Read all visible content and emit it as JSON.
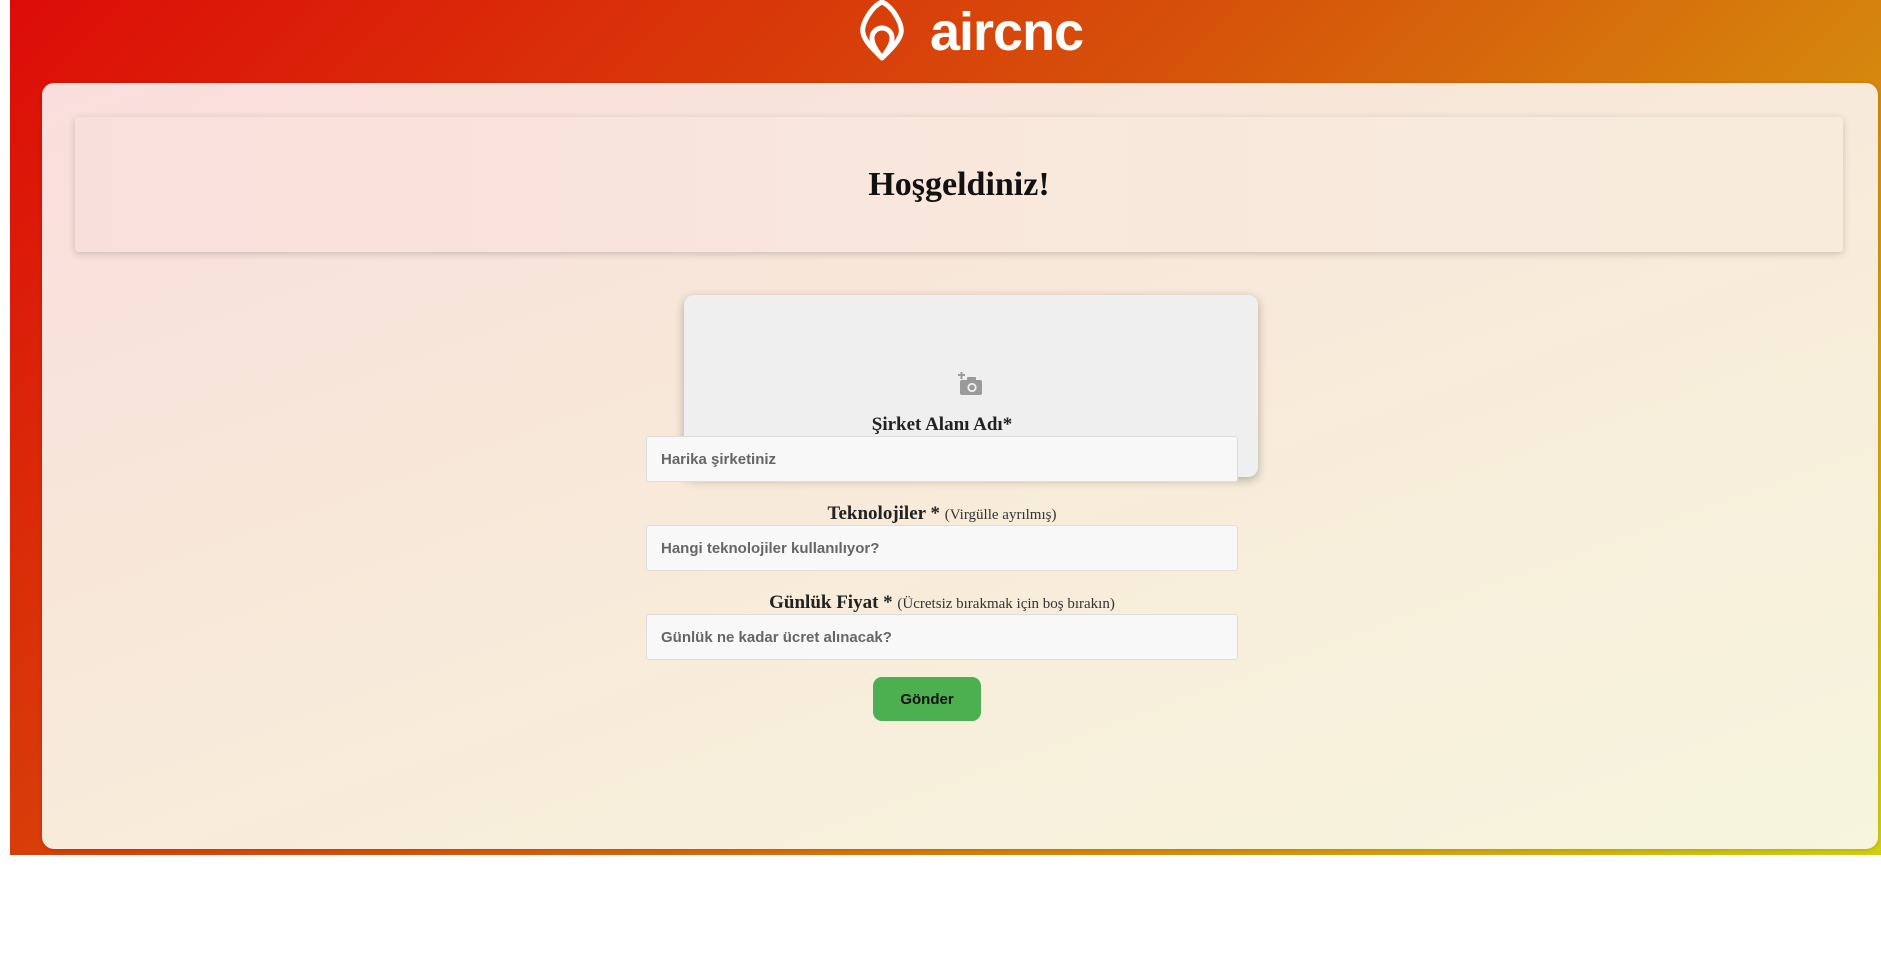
{
  "header": {
    "logo_text": "aircnc",
    "logo_icon": "airbnb-belo-icon"
  },
  "welcome": {
    "title": "Hoşgeldiniz!"
  },
  "upload": {
    "icon": "add-camera-icon"
  },
  "form": {
    "company": {
      "label": "Şirket Alanı Adı*",
      "placeholder": "Harika şirketiniz"
    },
    "techs": {
      "label": "Teknolojiler *",
      "hint": "(Virgülle ayrılmış)",
      "placeholder": "Hangi teknolojiler kullanılıyor?"
    },
    "price": {
      "label": "Günlük Fiyat *",
      "hint": "(Ücretsiz bırakmak için boş bırakın)",
      "placeholder": "Günlük ne kadar ücret alınacak?"
    },
    "submit_label": "Gönder"
  },
  "colors": {
    "gradient_start": "#dd0c08",
    "gradient_end": "#cfcf0f",
    "submit_button": "#4caf50"
  }
}
